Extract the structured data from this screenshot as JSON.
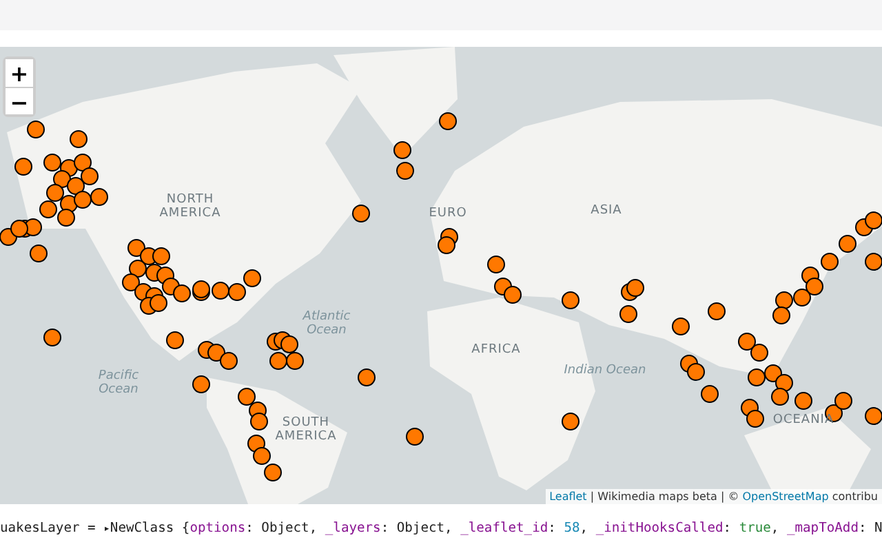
{
  "map": {
    "zoom_buttons": [
      "+",
      "−"
    ],
    "labels": [
      {
        "kind": "land",
        "text": "NORTH AMERICA"
      },
      {
        "kind": "land",
        "text": "EURO"
      },
      {
        "kind": "land",
        "text": "ASIA"
      },
      {
        "kind": "ocean",
        "text": "Atlantic Ocean"
      },
      {
        "kind": "land",
        "text": "AFRICA"
      },
      {
        "kind": "ocean",
        "text": "Pacific Ocean"
      },
      {
        "kind": "land",
        "text": "SOUTH AMERICA"
      },
      {
        "kind": "ocean",
        "text": "Indian Ocean"
      },
      {
        "kind": "land",
        "text": "OCEANIA"
      }
    ],
    "attribution": [
      {
        "kind": "link",
        "text": "Leaflet"
      },
      {
        "kind": "text",
        "text": "| Wikimedia maps beta | ©"
      },
      {
        "kind": "link",
        "text": "OpenStreetMap"
      },
      {
        "kind": "text",
        "text": "contribu"
      }
    ]
  },
  "console_line": [
    {
      "kind": "plain",
      "text": "uakesLayer = "
    },
    {
      "kind": "toggle",
      "text": "▸"
    },
    {
      "kind": "plain",
      "text": "NewClass {"
    },
    {
      "kind": "key",
      "text": "options"
    },
    {
      "kind": "plain",
      "text": ": Object, "
    },
    {
      "kind": "key",
      "text": "_layers"
    },
    {
      "kind": "plain",
      "text": ": Object, "
    },
    {
      "kind": "key",
      "text": "_leaflet_id"
    },
    {
      "kind": "plain",
      "text": ": "
    },
    {
      "kind": "number",
      "text": "58"
    },
    {
      "kind": "plain",
      "text": ", "
    },
    {
      "kind": "key",
      "text": "_initHooksCalled"
    },
    {
      "kind": "plain",
      "text": ": "
    },
    {
      "kind": "bool",
      "text": "true"
    },
    {
      "kind": "plain",
      "text": ", "
    },
    {
      "kind": "key",
      "text": "_mapToAdd"
    },
    {
      "kind": "plain",
      "text": ": N"
    }
  ]
}
